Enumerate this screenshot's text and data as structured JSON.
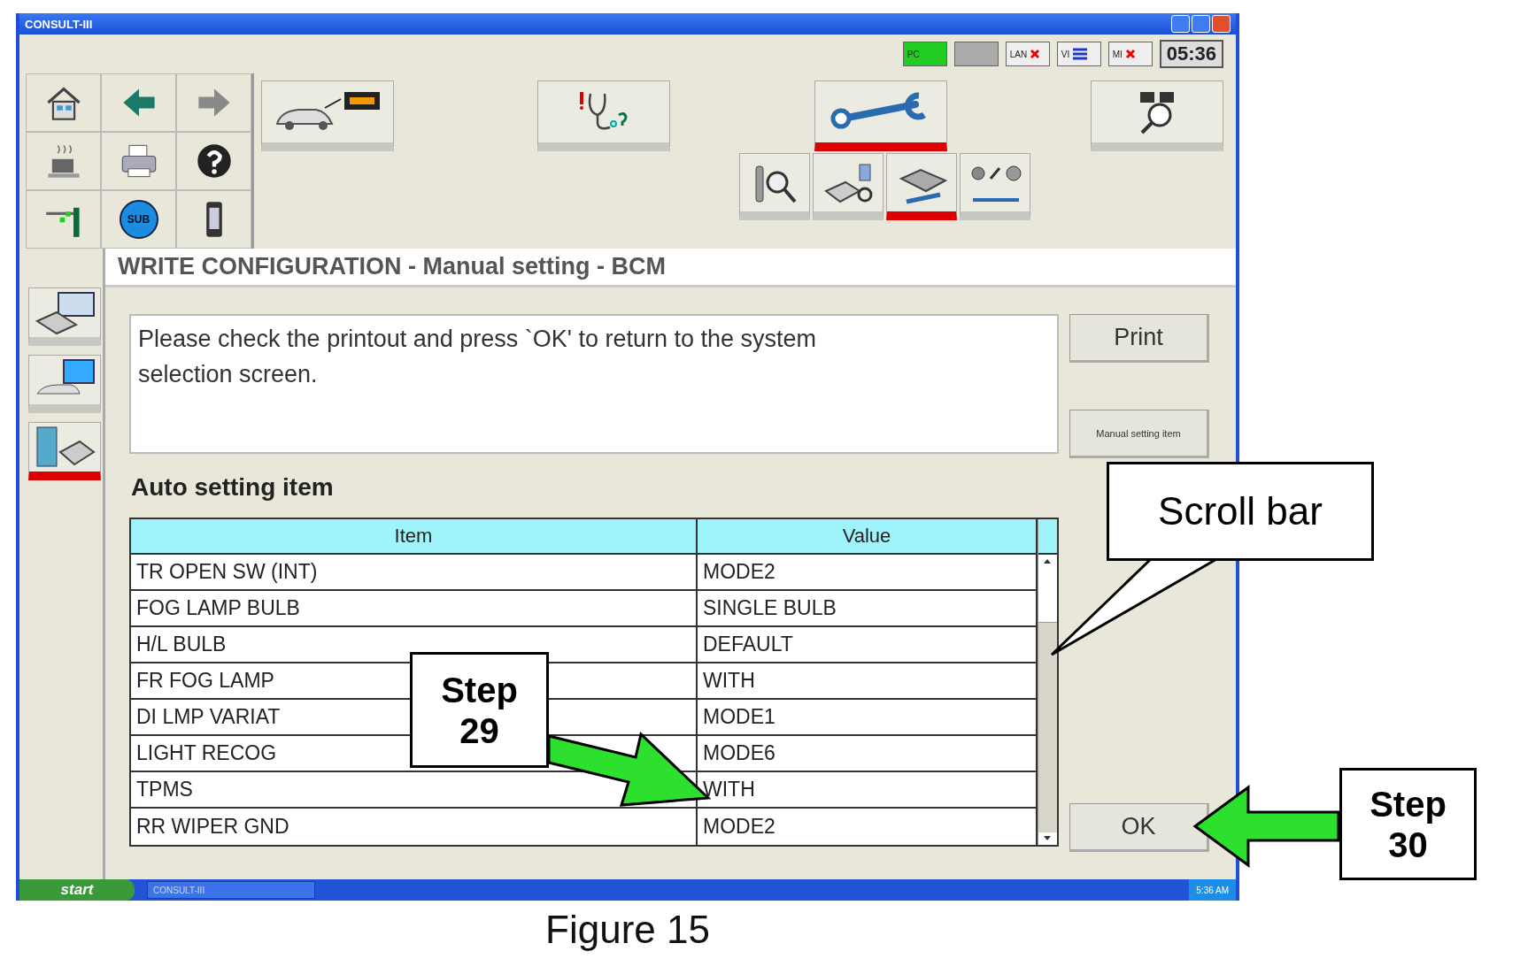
{
  "window": {
    "title": "CONSULT-III"
  },
  "status": {
    "indicators": [
      {
        "kind": "pc",
        "label": "PC"
      },
      {
        "kind": "battery"
      },
      {
        "kind": "lan",
        "label": "LAN"
      },
      {
        "kind": "vi",
        "label": "VI"
      },
      {
        "kind": "mi",
        "label": "MI"
      }
    ],
    "clock": "05:36"
  },
  "nav_buttons": [
    {
      "kind": "home"
    },
    {
      "kind": "back"
    },
    {
      "kind": "forward"
    },
    {
      "kind": "sleep"
    },
    {
      "kind": "print"
    },
    {
      "kind": "help"
    },
    {
      "kind": "screen"
    },
    {
      "kind": "sub",
      "label": "SUB"
    },
    {
      "kind": "device"
    }
  ],
  "function_buttons": [
    {
      "kind": "car",
      "selected": false
    },
    {
      "kind": "diagnosis",
      "selected": false
    },
    {
      "kind": "wrench",
      "selected": true
    },
    {
      "kind": "flags",
      "selected": false
    }
  ],
  "sub_buttons": [
    {
      "kind": "inspect",
      "selected": false
    },
    {
      "kind": "reprogram",
      "selected": false
    },
    {
      "kind": "configure",
      "selected": true
    },
    {
      "kind": "parts",
      "selected": false
    }
  ],
  "side_items": [
    {
      "kind": "monitor",
      "selected": false
    },
    {
      "kind": "pc",
      "selected": false
    },
    {
      "kind": "write",
      "selected": true
    }
  ],
  "screen_title": "WRITE CONFIGURATION - Manual setting - BCM",
  "message": "Please check the printout and press `OK' to return to the system selection screen.",
  "buttons": {
    "print": "Print",
    "manual": "Manual setting item",
    "ok": "OK"
  },
  "section_label": "Auto setting item",
  "table": {
    "columns": [
      "Item",
      "Value"
    ],
    "rows": [
      {
        "item": "TR OPEN SW (INT)",
        "value": "MODE2"
      },
      {
        "item": "FOG LAMP BULB",
        "value": "SINGLE BULB"
      },
      {
        "item": "H/L BULB",
        "value": "DEFAULT"
      },
      {
        "item": "FR FOG LAMP",
        "value": "WITH"
      },
      {
        "item": "DI LMP VARIAT",
        "value": "MODE1"
      },
      {
        "item": "LIGHT RECOG",
        "value": "MODE6"
      },
      {
        "item": "TPMS",
        "value": "WITH"
      },
      {
        "item": "RR WIPER GND",
        "value": "MODE2"
      }
    ]
  },
  "taskbar": {
    "start": "start",
    "task": "CONSULT-III",
    "clock": "5:36 AM"
  },
  "annotations": [
    {
      "kind": "callout",
      "lines": [
        "Scroll bar"
      ]
    },
    {
      "kind": "step",
      "lines": [
        "Step",
        "29"
      ]
    },
    {
      "kind": "step",
      "lines": [
        "Step",
        "30"
      ]
    }
  ],
  "caption": "Figure 15"
}
